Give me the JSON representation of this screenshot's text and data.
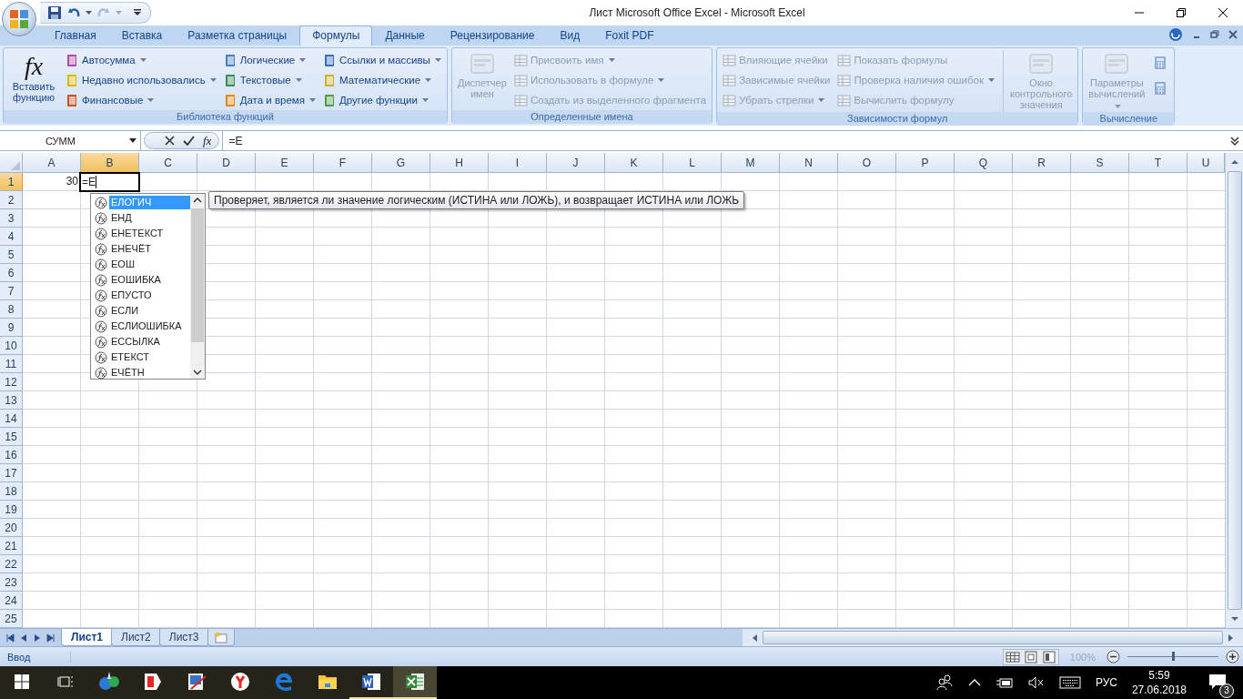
{
  "window": {
    "title": "Лист Microsoft Office Excel - Microsoft Excel"
  },
  "tabs": [
    {
      "label": "Главная",
      "selected": false
    },
    {
      "label": "Вставка",
      "selected": false
    },
    {
      "label": "Разметка страницы",
      "selected": false
    },
    {
      "label": "Формулы",
      "selected": true
    },
    {
      "label": "Данные",
      "selected": false
    },
    {
      "label": "Рецензирование",
      "selected": false
    },
    {
      "label": "Вид",
      "selected": false
    },
    {
      "label": "Foxit PDF",
      "selected": false
    }
  ],
  "ribbon": {
    "groups": [
      {
        "label": "Библиотека функций",
        "columns": [
          [
            {
              "kind": "large",
              "label": "Вставить функцию",
              "glyph": "fx",
              "dropdown": false,
              "disabled": false
            }
          ],
          [
            {
              "kind": "small",
              "label": "Автосумма",
              "dropdown": true,
              "disabled": false
            },
            {
              "kind": "small",
              "label": "Недавно использовались",
              "dropdown": true,
              "disabled": false
            },
            {
              "kind": "small",
              "label": "Финансовые",
              "dropdown": true,
              "disabled": false
            }
          ],
          [
            {
              "kind": "small",
              "label": "Логические",
              "dropdown": true,
              "disabled": false
            },
            {
              "kind": "small",
              "label": "Текстовые",
              "dropdown": true,
              "disabled": false
            },
            {
              "kind": "small",
              "label": "Дата и время",
              "dropdown": true,
              "disabled": false
            }
          ],
          [
            {
              "kind": "small",
              "label": "Ссылки и массивы",
              "dropdown": true,
              "disabled": false
            },
            {
              "kind": "small",
              "label": "Математические",
              "dropdown": true,
              "disabled": false
            },
            {
              "kind": "small",
              "label": "Другие функции",
              "dropdown": true,
              "disabled": false
            }
          ]
        ]
      },
      {
        "label": "Определенные имена",
        "columns": [
          [
            {
              "kind": "large",
              "label": "Диспетчер имен",
              "dropdown": false,
              "disabled": true
            }
          ],
          [
            {
              "kind": "small",
              "label": "Присвоить имя",
              "dropdown": true,
              "disabled": true
            },
            {
              "kind": "small",
              "label": "Использовать в формуле",
              "dropdown": true,
              "disabled": true
            },
            {
              "kind": "small",
              "label": "Создать из выделенного фрагмента",
              "dropdown": false,
              "disabled": true
            }
          ]
        ]
      },
      {
        "label": "Зависимости формул",
        "columns": [
          [
            {
              "kind": "small",
              "label": "Влияющие ячейки",
              "dropdown": false,
              "disabled": true
            },
            {
              "kind": "small",
              "label": "Зависимые ячейки",
              "dropdown": false,
              "disabled": true
            },
            {
              "kind": "small",
              "label": "Убрать стрелки",
              "dropdown": true,
              "disabled": true
            }
          ],
          [
            {
              "kind": "small",
              "label": "Показать формулы",
              "dropdown": false,
              "disabled": true
            },
            {
              "kind": "small",
              "label": "Проверка наличия ошибок",
              "dropdown": true,
              "disabled": true
            },
            {
              "kind": "small",
              "label": "Вычислить формулу",
              "dropdown": false,
              "disabled": true
            }
          ],
          [
            {
              "kind": "large",
              "label": "Окно контрольного значения",
              "dropdown": false,
              "disabled": true
            }
          ]
        ]
      },
      {
        "label": "Вычисление",
        "columns": [
          [
            {
              "kind": "large",
              "label": "Параметры вычислений",
              "dropdown": true,
              "disabled": true
            }
          ],
          [
            {
              "kind": "icon",
              "disabled": true
            },
            {
              "kind": "icon",
              "disabled": true
            }
          ]
        ]
      }
    ]
  },
  "formula_bar": {
    "name_box": "СУММ",
    "glyph": "fx",
    "formula": "=E"
  },
  "columns": [
    {
      "label": "A",
      "selected": false
    },
    {
      "label": "B",
      "selected": true
    },
    {
      "label": "C",
      "selected": false
    },
    {
      "label": "D",
      "selected": false
    },
    {
      "label": "E",
      "selected": false
    },
    {
      "label": "F",
      "selected": false
    },
    {
      "label": "G",
      "selected": false
    },
    {
      "label": "H",
      "selected": false
    },
    {
      "label": "I",
      "selected": false
    },
    {
      "label": "J",
      "selected": false
    },
    {
      "label": "K",
      "selected": false
    },
    {
      "label": "L",
      "selected": false
    },
    {
      "label": "M",
      "selected": false
    },
    {
      "label": "N",
      "selected": false
    },
    {
      "label": "O",
      "selected": false
    },
    {
      "label": "P",
      "selected": false
    },
    {
      "label": "Q",
      "selected": false
    },
    {
      "label": "R",
      "selected": false
    },
    {
      "label": "S",
      "selected": false
    },
    {
      "label": "T",
      "selected": false
    },
    {
      "label": "U",
      "selected": false
    }
  ],
  "rows": [
    {
      "label": "1",
      "selected": true,
      "cells": [
        {
          "value": "30",
          "kind": "number",
          "editing": false
        },
        {
          "value": "=E",
          "editing": true
        }
      ]
    },
    {
      "label": "2",
      "selected": false
    },
    {
      "label": "3",
      "selected": false
    },
    {
      "label": "4",
      "selected": false
    },
    {
      "label": "5",
      "selected": false
    },
    {
      "label": "6",
      "selected": false
    },
    {
      "label": "7",
      "selected": false
    },
    {
      "label": "8",
      "selected": false
    },
    {
      "label": "9",
      "selected": false
    },
    {
      "label": "10",
      "selected": false
    },
    {
      "label": "11",
      "selected": false
    },
    {
      "label": "12",
      "selected": false
    },
    {
      "label": "13",
      "selected": false
    },
    {
      "label": "14",
      "selected": false
    },
    {
      "label": "15",
      "selected": false
    },
    {
      "label": "16",
      "selected": false
    },
    {
      "label": "17",
      "selected": false
    },
    {
      "label": "18",
      "selected": false
    },
    {
      "label": "19",
      "selected": false
    },
    {
      "label": "20",
      "selected": false
    },
    {
      "label": "21",
      "selected": false
    },
    {
      "label": "22",
      "selected": false
    },
    {
      "label": "23",
      "selected": false
    },
    {
      "label": "24",
      "selected": false
    },
    {
      "label": "25",
      "selected": false
    }
  ],
  "autocomplete": {
    "items": [
      {
        "label": "ЕЛОГИЧ",
        "selected": true
      },
      {
        "label": "ЕНД",
        "selected": false
      },
      {
        "label": "ЕНЕТЕКСТ",
        "selected": false
      },
      {
        "label": "ЕНЕЧЁТ",
        "selected": false
      },
      {
        "label": "ЕОШ",
        "selected": false
      },
      {
        "label": "ЕОШИБКА",
        "selected": false
      },
      {
        "label": "ЕПУСТО",
        "selected": false
      },
      {
        "label": "ЕСЛИ",
        "selected": false
      },
      {
        "label": "ЕСЛИОШИБКА",
        "selected": false
      },
      {
        "label": "ЕССЫЛКА",
        "selected": false
      },
      {
        "label": "ЕТЕКСТ",
        "selected": false
      },
      {
        "label": "ЕЧЁТН",
        "selected": false
      }
    ],
    "tooltip": "Проверяет, является ли значение логическим (ИСТИНА или ЛОЖЬ), и возвращает ИСТИНА или ЛОЖЬ"
  },
  "sheet_tabs": [
    {
      "label": "Лист1",
      "selected": true
    },
    {
      "label": "Лист2",
      "selected": false
    },
    {
      "label": "Лист3",
      "selected": false
    }
  ],
  "status_bar": {
    "mode": "Ввод",
    "zoom": "100%",
    "zoom_slider": {
      "level": 0.5
    }
  },
  "taskbar": {
    "language": "РУС",
    "time": "5:59",
    "date": "27.06.2018",
    "notifications": "3"
  }
}
